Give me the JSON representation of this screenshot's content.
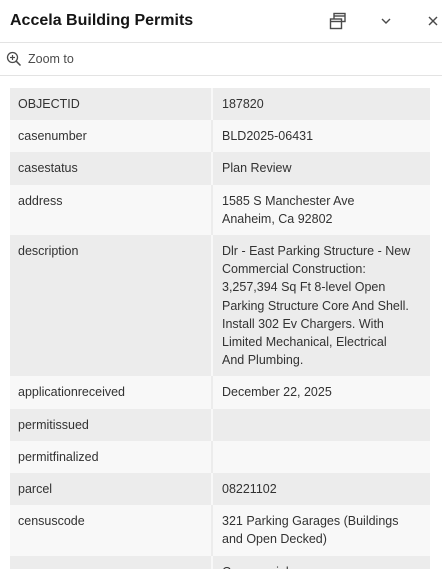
{
  "popup": {
    "title": "Accela Building Permits",
    "zoom_label": "Zoom to"
  },
  "icons": {
    "dock": "dock-icon",
    "collapse": "chevron-down-icon",
    "close": "close-icon",
    "zoom": "zoom-in-icon"
  },
  "attributes": [
    {
      "key": "OBJECTID",
      "value": "187820"
    },
    {
      "key": "casenumber",
      "value": "BLD2025-06431"
    },
    {
      "key": "casestatus",
      "value": "Plan Review"
    },
    {
      "key": "address",
      "value": "1585 S Manchester Ave\nAnaheim, Ca 92802"
    },
    {
      "key": "description",
      "value": "Dlr - East Parking Structure - New\nCommercial Construction:\n3,257,394 Sq Ft 8-level Open\nParking Structure Core And Shell.\nInstall 302 Ev Chargers. With\nLimited Mechanical, Electrical\nAnd Plumbing."
    },
    {
      "key": "applicationreceived",
      "value": "December 22, 2025"
    },
    {
      "key": "permitissued",
      "value": ""
    },
    {
      "key": "permitfinalized",
      "value": ""
    },
    {
      "key": "parcel",
      "value": "08221102"
    },
    {
      "key": "censuscode",
      "value": "321 Parking Garages (Buildings\nand Open Decked)"
    },
    {
      "key": "comres",
      "value": "Commercial"
    }
  ]
}
